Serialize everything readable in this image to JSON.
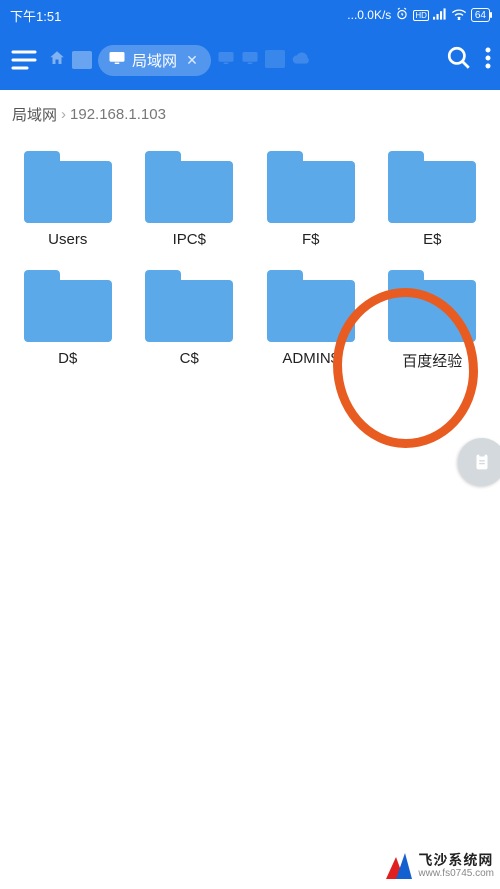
{
  "status": {
    "time": "下午1:51",
    "net_speed": "...0.0K/s",
    "battery": "64"
  },
  "appbar": {
    "active_tab_label": "局域网"
  },
  "breadcrumb": {
    "root": "局域网",
    "current": "192.168.1.103"
  },
  "folders": [
    {
      "label": "Users"
    },
    {
      "label": "IPC$"
    },
    {
      "label": "F$"
    },
    {
      "label": "E$"
    },
    {
      "label": "D$"
    },
    {
      "label": "C$"
    },
    {
      "label": "ADMIN$"
    },
    {
      "label": "百度经验"
    }
  ],
  "watermark": {
    "main": "飞沙系统网",
    "sub": "www.fs0745.com"
  }
}
